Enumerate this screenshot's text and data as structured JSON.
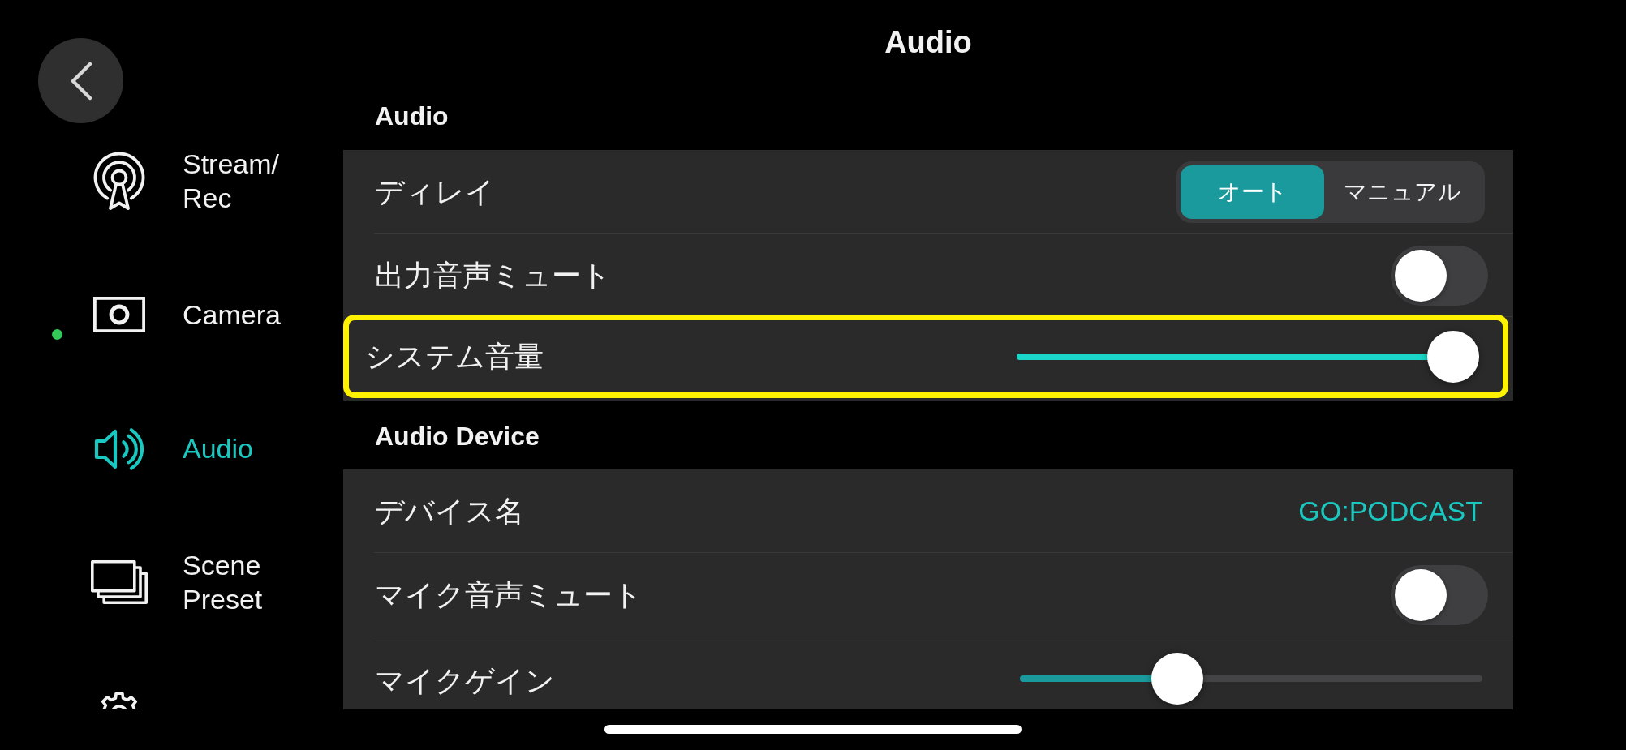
{
  "header": {
    "title": "Audio"
  },
  "sidebar": {
    "items": [
      {
        "kind": "stream",
        "label": "Stream/\nRec",
        "selected": false,
        "status_dot": false
      },
      {
        "kind": "camera",
        "label": "Camera",
        "selected": false,
        "status_dot": true
      },
      {
        "kind": "audio",
        "label": "Audio",
        "selected": true,
        "status_dot": false
      },
      {
        "kind": "scenes",
        "label": "Scene Preset",
        "selected": false,
        "status_dot": false
      },
      {
        "kind": "settings",
        "selected": false,
        "status_dot": false
      }
    ]
  },
  "sections": [
    {
      "title": "Audio",
      "rows": [
        {
          "kind": "segmented",
          "label": "ディレイ",
          "focused": false,
          "options": [
            {
              "label": "オート",
              "selected": true
            },
            {
              "label": "マニュアル",
              "selected": false
            }
          ]
        },
        {
          "kind": "toggle",
          "label": "出力音声ミュート",
          "focused": false,
          "on": false
        },
        {
          "kind": "slider",
          "label": "システム音量",
          "focused": true,
          "level": 1.0
        }
      ]
    },
    {
      "title": "Audio Device",
      "rows": [
        {
          "kind": "value",
          "label": "デバイス名",
          "focused": false,
          "value": "GO:PODCAST"
        },
        {
          "kind": "toggle",
          "label": "マイク音声ミュート",
          "focused": false,
          "on": false
        },
        {
          "kind": "slider",
          "label": "マイクゲイン",
          "focused": false,
          "level": 0.32
        }
      ]
    }
  ]
}
